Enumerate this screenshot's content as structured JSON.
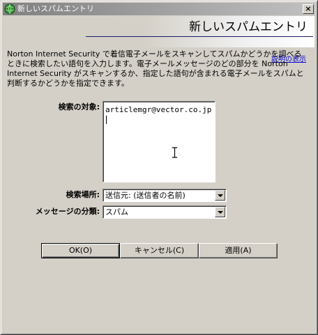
{
  "window": {
    "title": "新しいスパムエントリ",
    "close_label": "×"
  },
  "banner": {
    "heading": "新しいスパムエントリ",
    "help_link": "説明の表示"
  },
  "description": {
    "lines": [
      "Norton Internet Security で着信電子メールをスキャンしてスパムかどうかを調べる",
      "ときに検索したい語句を入力します。電子メールメッセージのどの部分を Norton",
      "Internet Security がスキャンするか、指定した語句が含まれる電子メールをスパムと",
      "判断するかどうかを指定できます。"
    ]
  },
  "form": {
    "search_target_label": "検索の対象:",
    "search_target_value": "articlemgr@vector.co.jp",
    "search_location_label": "検索場所:",
    "search_location_value": "送信元: (送信者の名前)",
    "category_label": "メッセージの分類:",
    "category_value": "スパム"
  },
  "buttons": {
    "ok": "OK(O)",
    "cancel": "キャンセル(C)",
    "apply": "適用(A)"
  },
  "icons": {
    "title_icon": "norton-globe-icon",
    "close_icon": "close-icon",
    "dropdown_icon": "chevron-down-icon",
    "cursor_icon": "ibeam-cursor-icon"
  }
}
